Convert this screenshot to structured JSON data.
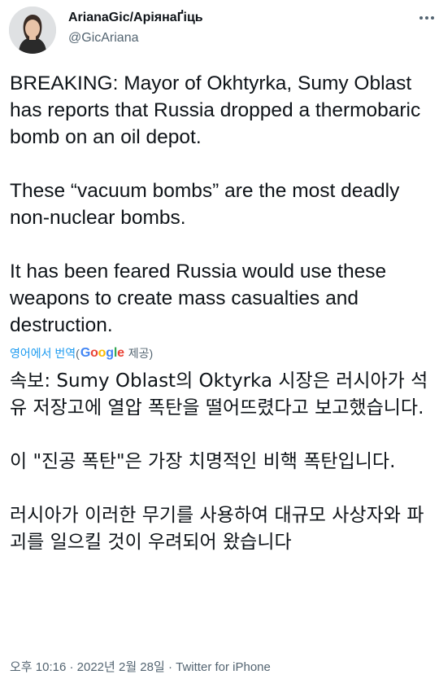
{
  "author": {
    "display_name": "ArianaGic/АріянаҐіць",
    "handle": "@GicAriana"
  },
  "tweet": {
    "paragraphs": [
      "BREAKING: Mayor of Okhtyrka, Sumy Oblast has reports that Russia dropped a thermobaric bomb on an oil depot.",
      "These “vacuum bombs” are the most deadly non-nuclear bombs.",
      "It has been feared Russia would use these weapons to create mass casualties and destruction."
    ]
  },
  "translation": {
    "link_label": "영어에서 번역",
    "open_paren": "(",
    "provider": "Google",
    "provided_label": "제공",
    "close_paren": ")",
    "paragraphs": [
      "속보: Sumy Oblast의 Oktyrka 시장은 러시아가 석유 저장고에 열압 폭탄을 떨어뜨렸다고 보고했습니다.",
      " 이 \"진공 폭탄\"은 가장 치명적인 비핵 폭탄입니다.",
      " 러시아가 이러한 무기를 사용하여 대규모 사상자와 파괴를 일으킬 것이 우려되어 왔습니다"
    ]
  },
  "meta": {
    "time": "오후 10:16",
    "separator": " · ",
    "date": "2022년 2월 28일",
    "separator2": " · ",
    "source": "Twitter for iPhone"
  },
  "icons": {
    "avatar": "profile-photo",
    "more": "more-horizontal-icon"
  },
  "colors": {
    "text": "#0f1419",
    "secondary": "#536471",
    "link": "#1d9bf0",
    "google_blue": "#4285F4",
    "google_red": "#EA4335",
    "google_yellow": "#FBBC05",
    "google_green": "#34A853"
  }
}
